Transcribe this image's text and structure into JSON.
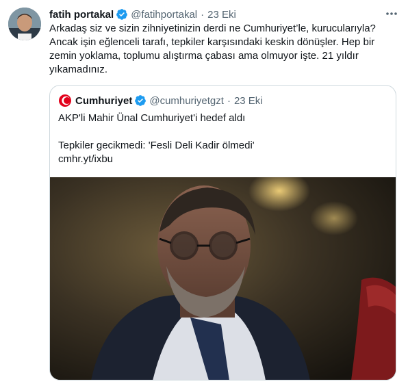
{
  "tweet": {
    "author_name": "fatih portakal",
    "author_handle": "@fatihportakal",
    "separator": "·",
    "date": "23 Eki",
    "lines": [
      "Arkadaş siz ve sizin zihniyetinizin derdi ne Cumhuriyet’le, kurucularıyla?",
      "Ancak işin eğlenceli tarafı, tepkiler karşısındaki keskin dönüşler. Hep bir",
      "zemin yoklama, toplumu alıştırma çabası ama olmuyor işte. 21 yıldır",
      "yıkamadınız."
    ]
  },
  "quote": {
    "author_name": "Cumhuriyet",
    "author_handle": "@cumhuriyetgzt",
    "separator": "·",
    "date": "23 Eki",
    "headline": "AKP'li Mahir Ünal Cumhuriyet'i hedef aldı",
    "subline": "Tepkiler gecikmedi: 'Fesli Deli Kadir ölmedi'",
    "link": "cmhr.yt/ixbu"
  },
  "icons": {
    "verified": "verified-badge-icon",
    "more": "more-options-icon",
    "cumhuriyet_logo": "cumhuriyet-logo-icon"
  },
  "colors": {
    "verified_blue": "#1d9bf0",
    "secondary_text": "#536471",
    "border": "#cfd9de",
    "cumhuriyet_red": "#e2001a"
  }
}
